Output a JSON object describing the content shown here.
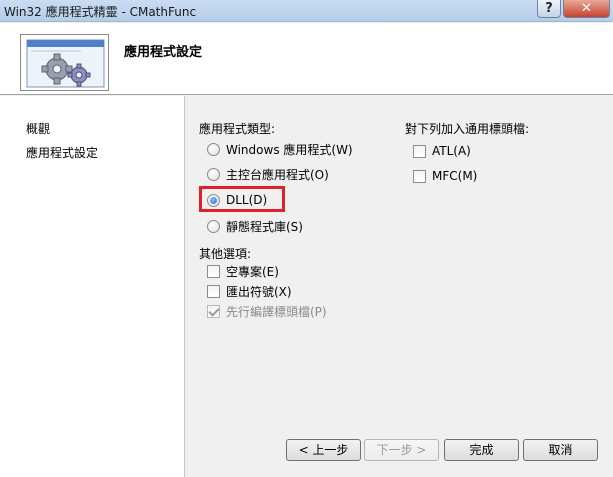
{
  "window": {
    "title": "Win32 應用程式精靈 - CMathFunc",
    "help_glyph": "?",
    "close_glyph": "✕"
  },
  "header": {
    "title": "應用程式設定"
  },
  "sidebar": {
    "items": [
      {
        "label": "概觀"
      },
      {
        "label": "應用程式設定"
      }
    ]
  },
  "app_type": {
    "label": "應用程式類型:",
    "selected": "DLL(D)",
    "options": [
      {
        "label": "Windows 應用程式(W)",
        "checked": false
      },
      {
        "label": "主控台應用程式(O)",
        "checked": false
      },
      {
        "label": "DLL(D)",
        "checked": true
      },
      {
        "label": "靜態程式庫(S)",
        "checked": false
      }
    ]
  },
  "other_options": {
    "label": "其他選項:",
    "items": [
      {
        "label": "空專案(E)",
        "checked": false,
        "enabled": true
      },
      {
        "label": "匯出符號(X)",
        "checked": false,
        "enabled": true
      },
      {
        "label": "先行編譯標頭檔(P)",
        "checked": true,
        "enabled": false
      }
    ]
  },
  "common_headers": {
    "label": "對下列加入通用標頭檔:",
    "items": [
      {
        "label": "ATL(A)",
        "checked": false
      },
      {
        "label": "MFC(M)",
        "checked": false
      }
    ]
  },
  "buttons": {
    "prev": "< 上一步",
    "next": "下一步 >",
    "finish": "完成",
    "cancel": "取消"
  },
  "colors": {
    "highlight_border": "#e0202a",
    "radio_selected": "#1d6fce"
  }
}
